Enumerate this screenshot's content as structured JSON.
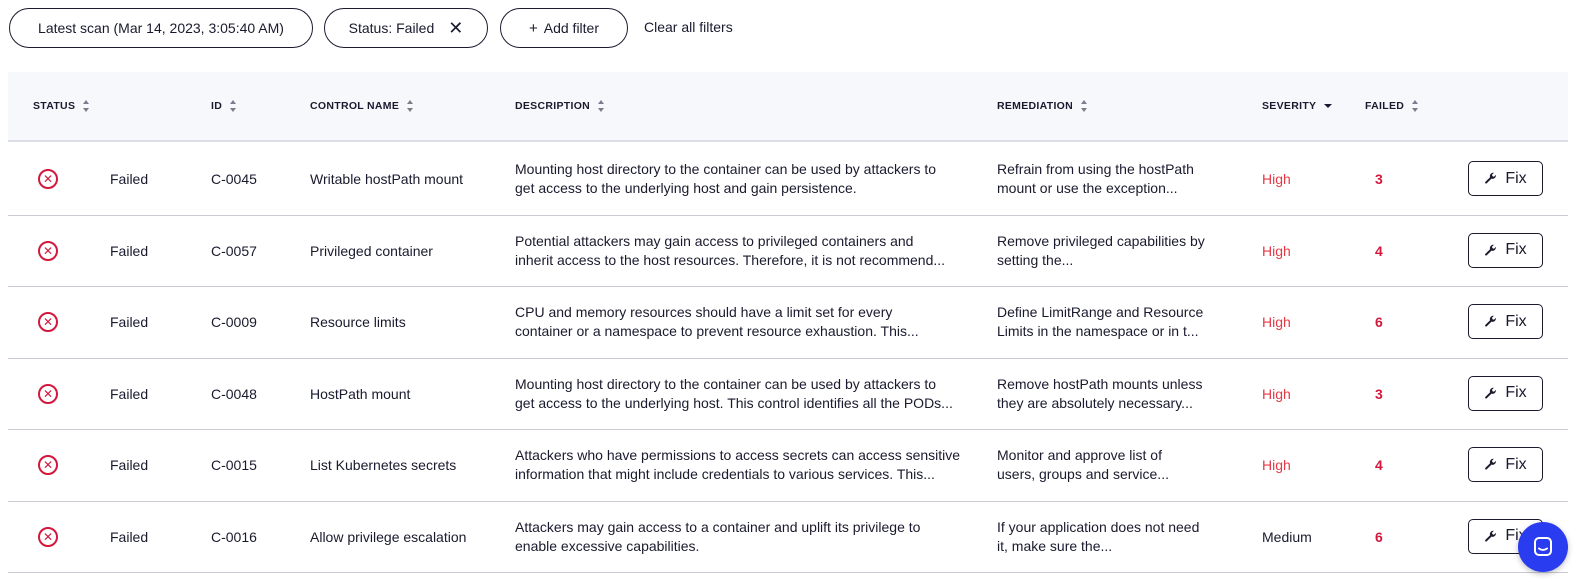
{
  "filters": {
    "scan_label": "Latest scan (Mar 14, 2023, 3:05:40 AM)",
    "status_label": "Status: Failed",
    "status_close": "✕",
    "add_plus": "+",
    "add_label": "Add filter",
    "clear_label": "Clear all filters"
  },
  "table": {
    "headers": {
      "status": "STATUS",
      "id": "ID",
      "control_name": "CONTROL NAME",
      "description": "DESCRIPTION",
      "remediation": "REMEDIATION",
      "severity": "SEVERITY",
      "failed": "FAILED"
    },
    "fix_label": "Fix",
    "rows": [
      {
        "status": "Failed",
        "id": "C-0045",
        "name": "Writable hostPath mount",
        "desc1": "Mounting host directory to the container can be used by attackers to",
        "desc2": "get access to the underlying host and gain persistence.",
        "rem1": "Refrain from using the hostPath",
        "rem2": "mount or use the exception...",
        "severity": "High",
        "failed": "3"
      },
      {
        "status": "Failed",
        "id": "C-0057",
        "name": "Privileged container",
        "desc1": "Potential attackers may gain access to privileged containers and",
        "desc2": "inherit access to the host resources. Therefore, it is not recommend...",
        "rem1": "Remove privileged capabilities by",
        "rem2": "setting the...",
        "severity": "High",
        "failed": "4"
      },
      {
        "status": "Failed",
        "id": "C-0009",
        "name": "Resource limits",
        "desc1": "CPU and memory resources should have a limit set for every",
        "desc2": "container or a namespace to prevent resource exhaustion. This...",
        "rem1": "Define LimitRange and Resource",
        "rem2": "Limits in the namespace or in t...",
        "severity": "High",
        "failed": "6"
      },
      {
        "status": "Failed",
        "id": "C-0048",
        "name": "HostPath mount",
        "desc1": "Mounting host directory to the container can be used by attackers to",
        "desc2": "get access to the underlying host. This control identifies all the PODs...",
        "rem1": "Remove hostPath mounts unless",
        "rem2": "they are absolutely necessary...",
        "severity": "High",
        "failed": "3"
      },
      {
        "status": "Failed",
        "id": "C-0015",
        "name": "List Kubernetes secrets",
        "desc1": "Attackers who have permissions to access secrets can access sensitive",
        "desc2": "information that might include credentials to various services. This...",
        "rem1": "Monitor and approve list of",
        "rem2": "users, groups and service...",
        "severity": "High",
        "failed": "4"
      },
      {
        "status": "Failed",
        "id": "C-0016",
        "name": "Allow privilege escalation",
        "desc1": "Attackers may gain access to a container and uplift its privilege to",
        "desc2": "enable excessive capabilities.",
        "rem1": "If your application does not need",
        "rem2": "it, make sure the...",
        "severity": "Medium",
        "failed": "6"
      }
    ]
  },
  "colors": {
    "failed_red": "#d4183d",
    "high_red": "#e53945",
    "chat_blue": "#2a3cf0",
    "header_bg": "#f7f8fc"
  },
  "icons": {
    "status_failed": "circle-x-icon",
    "fix": "wrench-icon",
    "chat": "chat-icon",
    "sort": "sort-icon"
  }
}
